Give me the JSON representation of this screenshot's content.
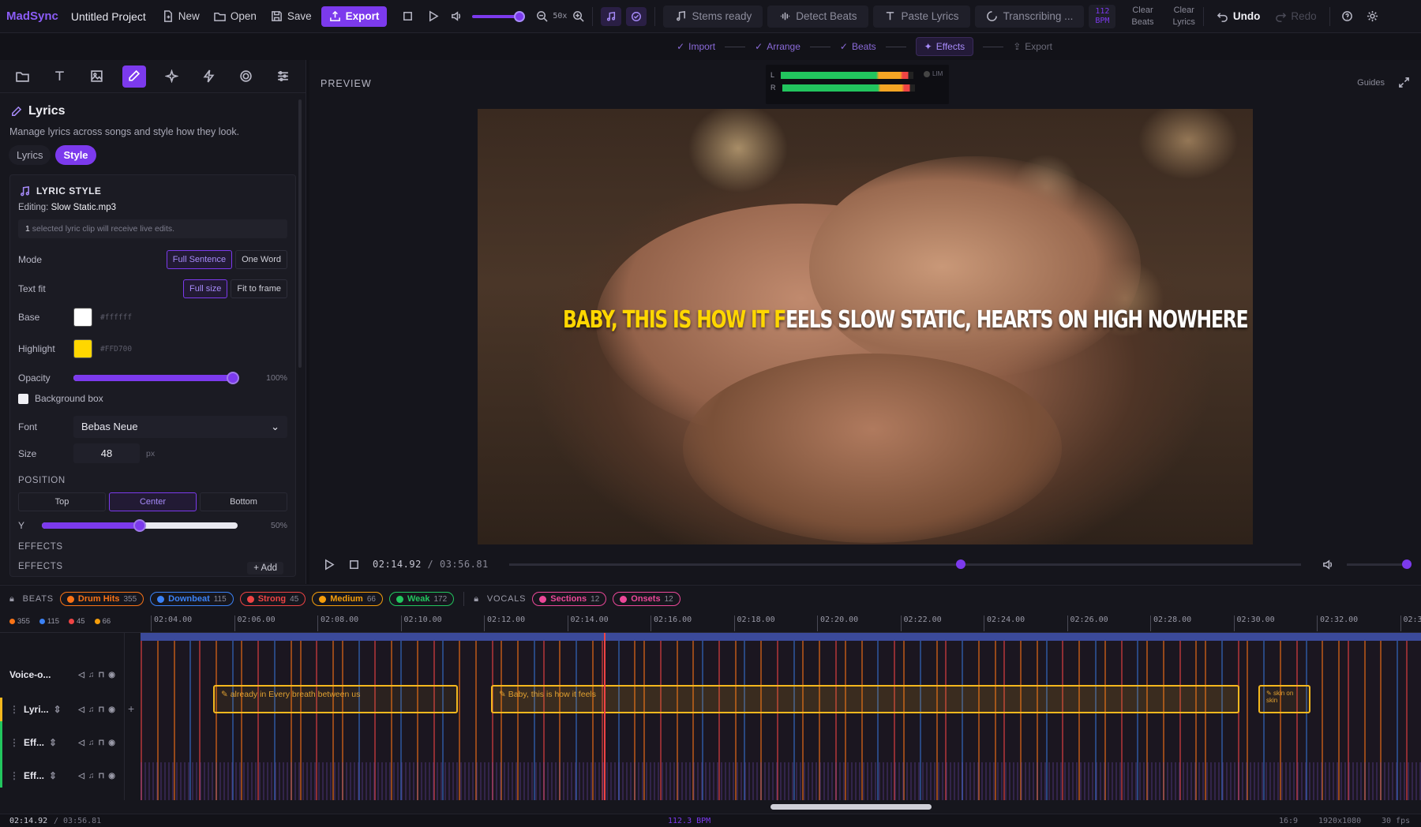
{
  "app": {
    "brand": "MadSync",
    "project": "Untitled Project"
  },
  "toolbar": {
    "new": "New",
    "open": "Open",
    "save": "Save",
    "export": "Export",
    "zoom": "50x",
    "stems": "Stems ready",
    "detect_beats": "Detect Beats",
    "paste_lyrics": "Paste Lyrics",
    "transcribing": "Transcribing ...",
    "bpm_value": "112",
    "bpm_unit": "BPM",
    "clear_beats_1": "Clear",
    "clear_beats_2": "Beats",
    "clear_lyrics_1": "Clear",
    "clear_lyrics_2": "Lyrics",
    "undo": "Undo",
    "redo": "Redo"
  },
  "steps": [
    "Import",
    "Arrange",
    "Beats",
    "Effects",
    "Export"
  ],
  "panel": {
    "title": "Lyrics",
    "desc": "Manage lyrics across songs and style how they look.",
    "tabs": [
      "Lyrics",
      "Style"
    ],
    "card_title": "LYRIC STYLE",
    "editing_label": "Editing:",
    "editing_file": "Slow Static.mp3",
    "note_count": "1",
    "note_text": "selected lyric clip will receive live edits.",
    "mode_label": "Mode",
    "mode_opts": [
      "Full Sentence",
      "One Word"
    ],
    "fit_label": "Text fit",
    "fit_opts": [
      "Full size",
      "Fit to frame"
    ],
    "base_label": "Base",
    "base_hex": "#ffffff",
    "highlight_label": "Highlight",
    "highlight_hex": "#FFD700",
    "opacity_label": "Opacity",
    "opacity_value": "100%",
    "bgbox_label": "Background box",
    "font_label": "Font",
    "font_value": "Bebas Neue",
    "size_label": "Size",
    "size_value": "48",
    "size_unit": "px",
    "position_label": "POSITION",
    "position_opts": [
      "Top",
      "Center",
      "Bottom"
    ],
    "y_label": "Y",
    "y_value": "50%",
    "effects_label_1": "EFFECTS",
    "effects_label_2": "EFFECTS",
    "add": "Add"
  },
  "preview": {
    "title": "PREVIEW",
    "guides": "Guides",
    "meter_l": "L",
    "meter_r": "R",
    "lim": "LIM",
    "lyric_highlight": "BABY, THIS IS HOW IT F",
    "lyric_rest": "EELS SLOW STATIC, HEARTS ON HIGH NOWHERE",
    "time_current": "02:14.92",
    "time_total": "03:56.81",
    "time_sep": " / ",
    "scrub_position": 0.57
  },
  "timeline": {
    "beats_label": "BEATS",
    "vocals_label": "VOCALS",
    "pills": [
      {
        "label": "Drum Hits",
        "count": "355",
        "color": "#f97316"
      },
      {
        "label": "Downbeat",
        "count": "115",
        "color": "#3b82f6"
      },
      {
        "label": "Strong",
        "count": "45",
        "color": "#ef4444"
      },
      {
        "label": "Medium",
        "count": "66",
        "color": "#f59e0b"
      },
      {
        "label": "Weak",
        "count": "172",
        "color": "#22c55e"
      }
    ],
    "vpills": [
      {
        "label": "Sections",
        "count": "12",
        "color": "#ec4899"
      },
      {
        "label": "Onsets",
        "count": "12",
        "color": "#ec4899"
      }
    ],
    "counts": [
      "355",
      "115",
      "45",
      "66"
    ],
    "ticks": [
      "02:04.00",
      "02:06.00",
      "02:08.00",
      "02:10.00",
      "02:12.00",
      "02:14.00",
      "02:16.00",
      "02:18.00",
      "02:20.00",
      "02:22.00",
      "02:24.00",
      "02:26.00",
      "02:28.00",
      "02:30.00",
      "02:32.00",
      "02:3"
    ],
    "tracks": [
      "Voice-o...",
      "Lyri...",
      "Eff...",
      "Eff..."
    ],
    "clips": [
      "already in Every breath between us",
      "Baby, this is how it feels",
      "skin on skin"
    ]
  },
  "status": {
    "time": "02:14.92",
    "total": "/ 03:56.81",
    "bpm": "112.3 BPM",
    "aspect": "16:9",
    "res": "1920x1080",
    "fps": "30 fps"
  }
}
